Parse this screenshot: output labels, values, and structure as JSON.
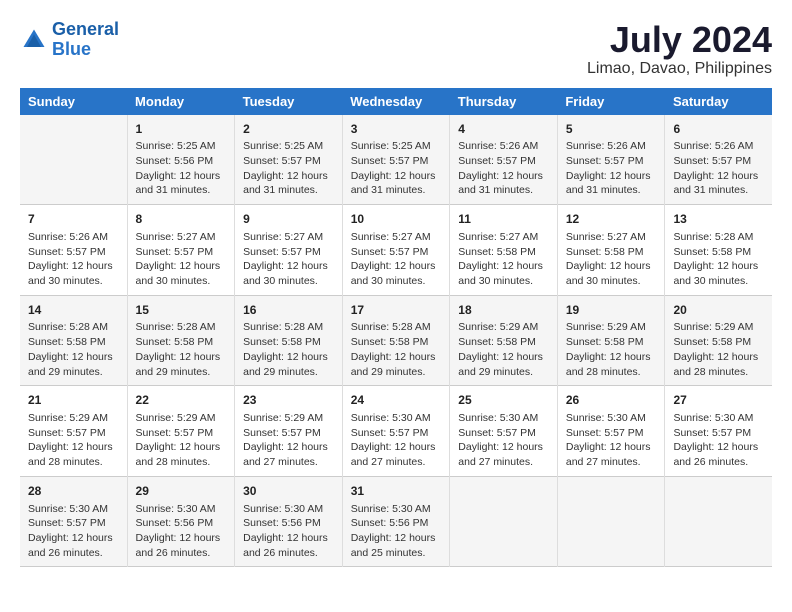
{
  "logo": {
    "line1": "General",
    "line2": "Blue"
  },
  "title": "July 2024",
  "subtitle": "Limao, Davao, Philippines",
  "headers": [
    "Sunday",
    "Monday",
    "Tuesday",
    "Wednesday",
    "Thursday",
    "Friday",
    "Saturday"
  ],
  "weeks": [
    [
      {
        "day": "",
        "info": ""
      },
      {
        "day": "1",
        "info": "Sunrise: 5:25 AM\nSunset: 5:56 PM\nDaylight: 12 hours\nand 31 minutes."
      },
      {
        "day": "2",
        "info": "Sunrise: 5:25 AM\nSunset: 5:57 PM\nDaylight: 12 hours\nand 31 minutes."
      },
      {
        "day": "3",
        "info": "Sunrise: 5:25 AM\nSunset: 5:57 PM\nDaylight: 12 hours\nand 31 minutes."
      },
      {
        "day": "4",
        "info": "Sunrise: 5:26 AM\nSunset: 5:57 PM\nDaylight: 12 hours\nand 31 minutes."
      },
      {
        "day": "5",
        "info": "Sunrise: 5:26 AM\nSunset: 5:57 PM\nDaylight: 12 hours\nand 31 minutes."
      },
      {
        "day": "6",
        "info": "Sunrise: 5:26 AM\nSunset: 5:57 PM\nDaylight: 12 hours\nand 31 minutes."
      }
    ],
    [
      {
        "day": "7",
        "info": "Sunrise: 5:26 AM\nSunset: 5:57 PM\nDaylight: 12 hours\nand 30 minutes."
      },
      {
        "day": "8",
        "info": "Sunrise: 5:27 AM\nSunset: 5:57 PM\nDaylight: 12 hours\nand 30 minutes."
      },
      {
        "day": "9",
        "info": "Sunrise: 5:27 AM\nSunset: 5:57 PM\nDaylight: 12 hours\nand 30 minutes."
      },
      {
        "day": "10",
        "info": "Sunrise: 5:27 AM\nSunset: 5:57 PM\nDaylight: 12 hours\nand 30 minutes."
      },
      {
        "day": "11",
        "info": "Sunrise: 5:27 AM\nSunset: 5:58 PM\nDaylight: 12 hours\nand 30 minutes."
      },
      {
        "day": "12",
        "info": "Sunrise: 5:27 AM\nSunset: 5:58 PM\nDaylight: 12 hours\nand 30 minutes."
      },
      {
        "day": "13",
        "info": "Sunrise: 5:28 AM\nSunset: 5:58 PM\nDaylight: 12 hours\nand 30 minutes."
      }
    ],
    [
      {
        "day": "14",
        "info": "Sunrise: 5:28 AM\nSunset: 5:58 PM\nDaylight: 12 hours\nand 29 minutes."
      },
      {
        "day": "15",
        "info": "Sunrise: 5:28 AM\nSunset: 5:58 PM\nDaylight: 12 hours\nand 29 minutes."
      },
      {
        "day": "16",
        "info": "Sunrise: 5:28 AM\nSunset: 5:58 PM\nDaylight: 12 hours\nand 29 minutes."
      },
      {
        "day": "17",
        "info": "Sunrise: 5:28 AM\nSunset: 5:58 PM\nDaylight: 12 hours\nand 29 minutes."
      },
      {
        "day": "18",
        "info": "Sunrise: 5:29 AM\nSunset: 5:58 PM\nDaylight: 12 hours\nand 29 minutes."
      },
      {
        "day": "19",
        "info": "Sunrise: 5:29 AM\nSunset: 5:58 PM\nDaylight: 12 hours\nand 28 minutes."
      },
      {
        "day": "20",
        "info": "Sunrise: 5:29 AM\nSunset: 5:58 PM\nDaylight: 12 hours\nand 28 minutes."
      }
    ],
    [
      {
        "day": "21",
        "info": "Sunrise: 5:29 AM\nSunset: 5:57 PM\nDaylight: 12 hours\nand 28 minutes."
      },
      {
        "day": "22",
        "info": "Sunrise: 5:29 AM\nSunset: 5:57 PM\nDaylight: 12 hours\nand 28 minutes."
      },
      {
        "day": "23",
        "info": "Sunrise: 5:29 AM\nSunset: 5:57 PM\nDaylight: 12 hours\nand 27 minutes."
      },
      {
        "day": "24",
        "info": "Sunrise: 5:30 AM\nSunset: 5:57 PM\nDaylight: 12 hours\nand 27 minutes."
      },
      {
        "day": "25",
        "info": "Sunrise: 5:30 AM\nSunset: 5:57 PM\nDaylight: 12 hours\nand 27 minutes."
      },
      {
        "day": "26",
        "info": "Sunrise: 5:30 AM\nSunset: 5:57 PM\nDaylight: 12 hours\nand 27 minutes."
      },
      {
        "day": "27",
        "info": "Sunrise: 5:30 AM\nSunset: 5:57 PM\nDaylight: 12 hours\nand 26 minutes."
      }
    ],
    [
      {
        "day": "28",
        "info": "Sunrise: 5:30 AM\nSunset: 5:57 PM\nDaylight: 12 hours\nand 26 minutes."
      },
      {
        "day": "29",
        "info": "Sunrise: 5:30 AM\nSunset: 5:56 PM\nDaylight: 12 hours\nand 26 minutes."
      },
      {
        "day": "30",
        "info": "Sunrise: 5:30 AM\nSunset: 5:56 PM\nDaylight: 12 hours\nand 26 minutes."
      },
      {
        "day": "31",
        "info": "Sunrise: 5:30 AM\nSunset: 5:56 PM\nDaylight: 12 hours\nand 25 minutes."
      },
      {
        "day": "",
        "info": ""
      },
      {
        "day": "",
        "info": ""
      },
      {
        "day": "",
        "info": ""
      }
    ]
  ]
}
